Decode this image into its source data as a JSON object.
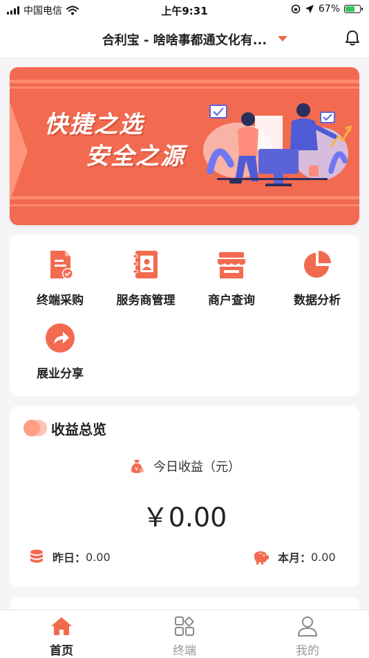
{
  "status_bar": {
    "carrier": "中国电信",
    "time": "上午9:31",
    "battery": "67%",
    "battery_level": 0.67
  },
  "nav": {
    "title": "合利宝 - 啥啥事都通文化有...",
    "caret_icon": "caret-down-icon",
    "bell_icon": "bell-icon"
  },
  "banner": {
    "line1": "快捷之选",
    "line2": "安全之源"
  },
  "menu": {
    "items": [
      {
        "label": "终端采购",
        "icon": "document-check-icon"
      },
      {
        "label": "服务商管理",
        "icon": "contact-book-icon"
      },
      {
        "label": "商户查询",
        "icon": "storefront-icon"
      },
      {
        "label": "数据分析",
        "icon": "pie-chart-icon"
      },
      {
        "label": "展业分享",
        "icon": "share-arrow-icon"
      }
    ]
  },
  "earnings": {
    "title": "收益总览",
    "today_label": "今日收益（元）",
    "amount": "￥0.00",
    "yesterday_label": "昨日：",
    "yesterday_value": "0.00",
    "month_label": "本月：",
    "month_value": "0.00"
  },
  "tabs": [
    {
      "label": "首页",
      "icon": "home-icon",
      "active": true
    },
    {
      "label": "终端",
      "icon": "grid-icon",
      "active": false
    },
    {
      "label": "我的",
      "icon": "user-icon",
      "active": false
    }
  ],
  "colors": {
    "accent": "#f06b4b",
    "banner": "#f26a50"
  }
}
